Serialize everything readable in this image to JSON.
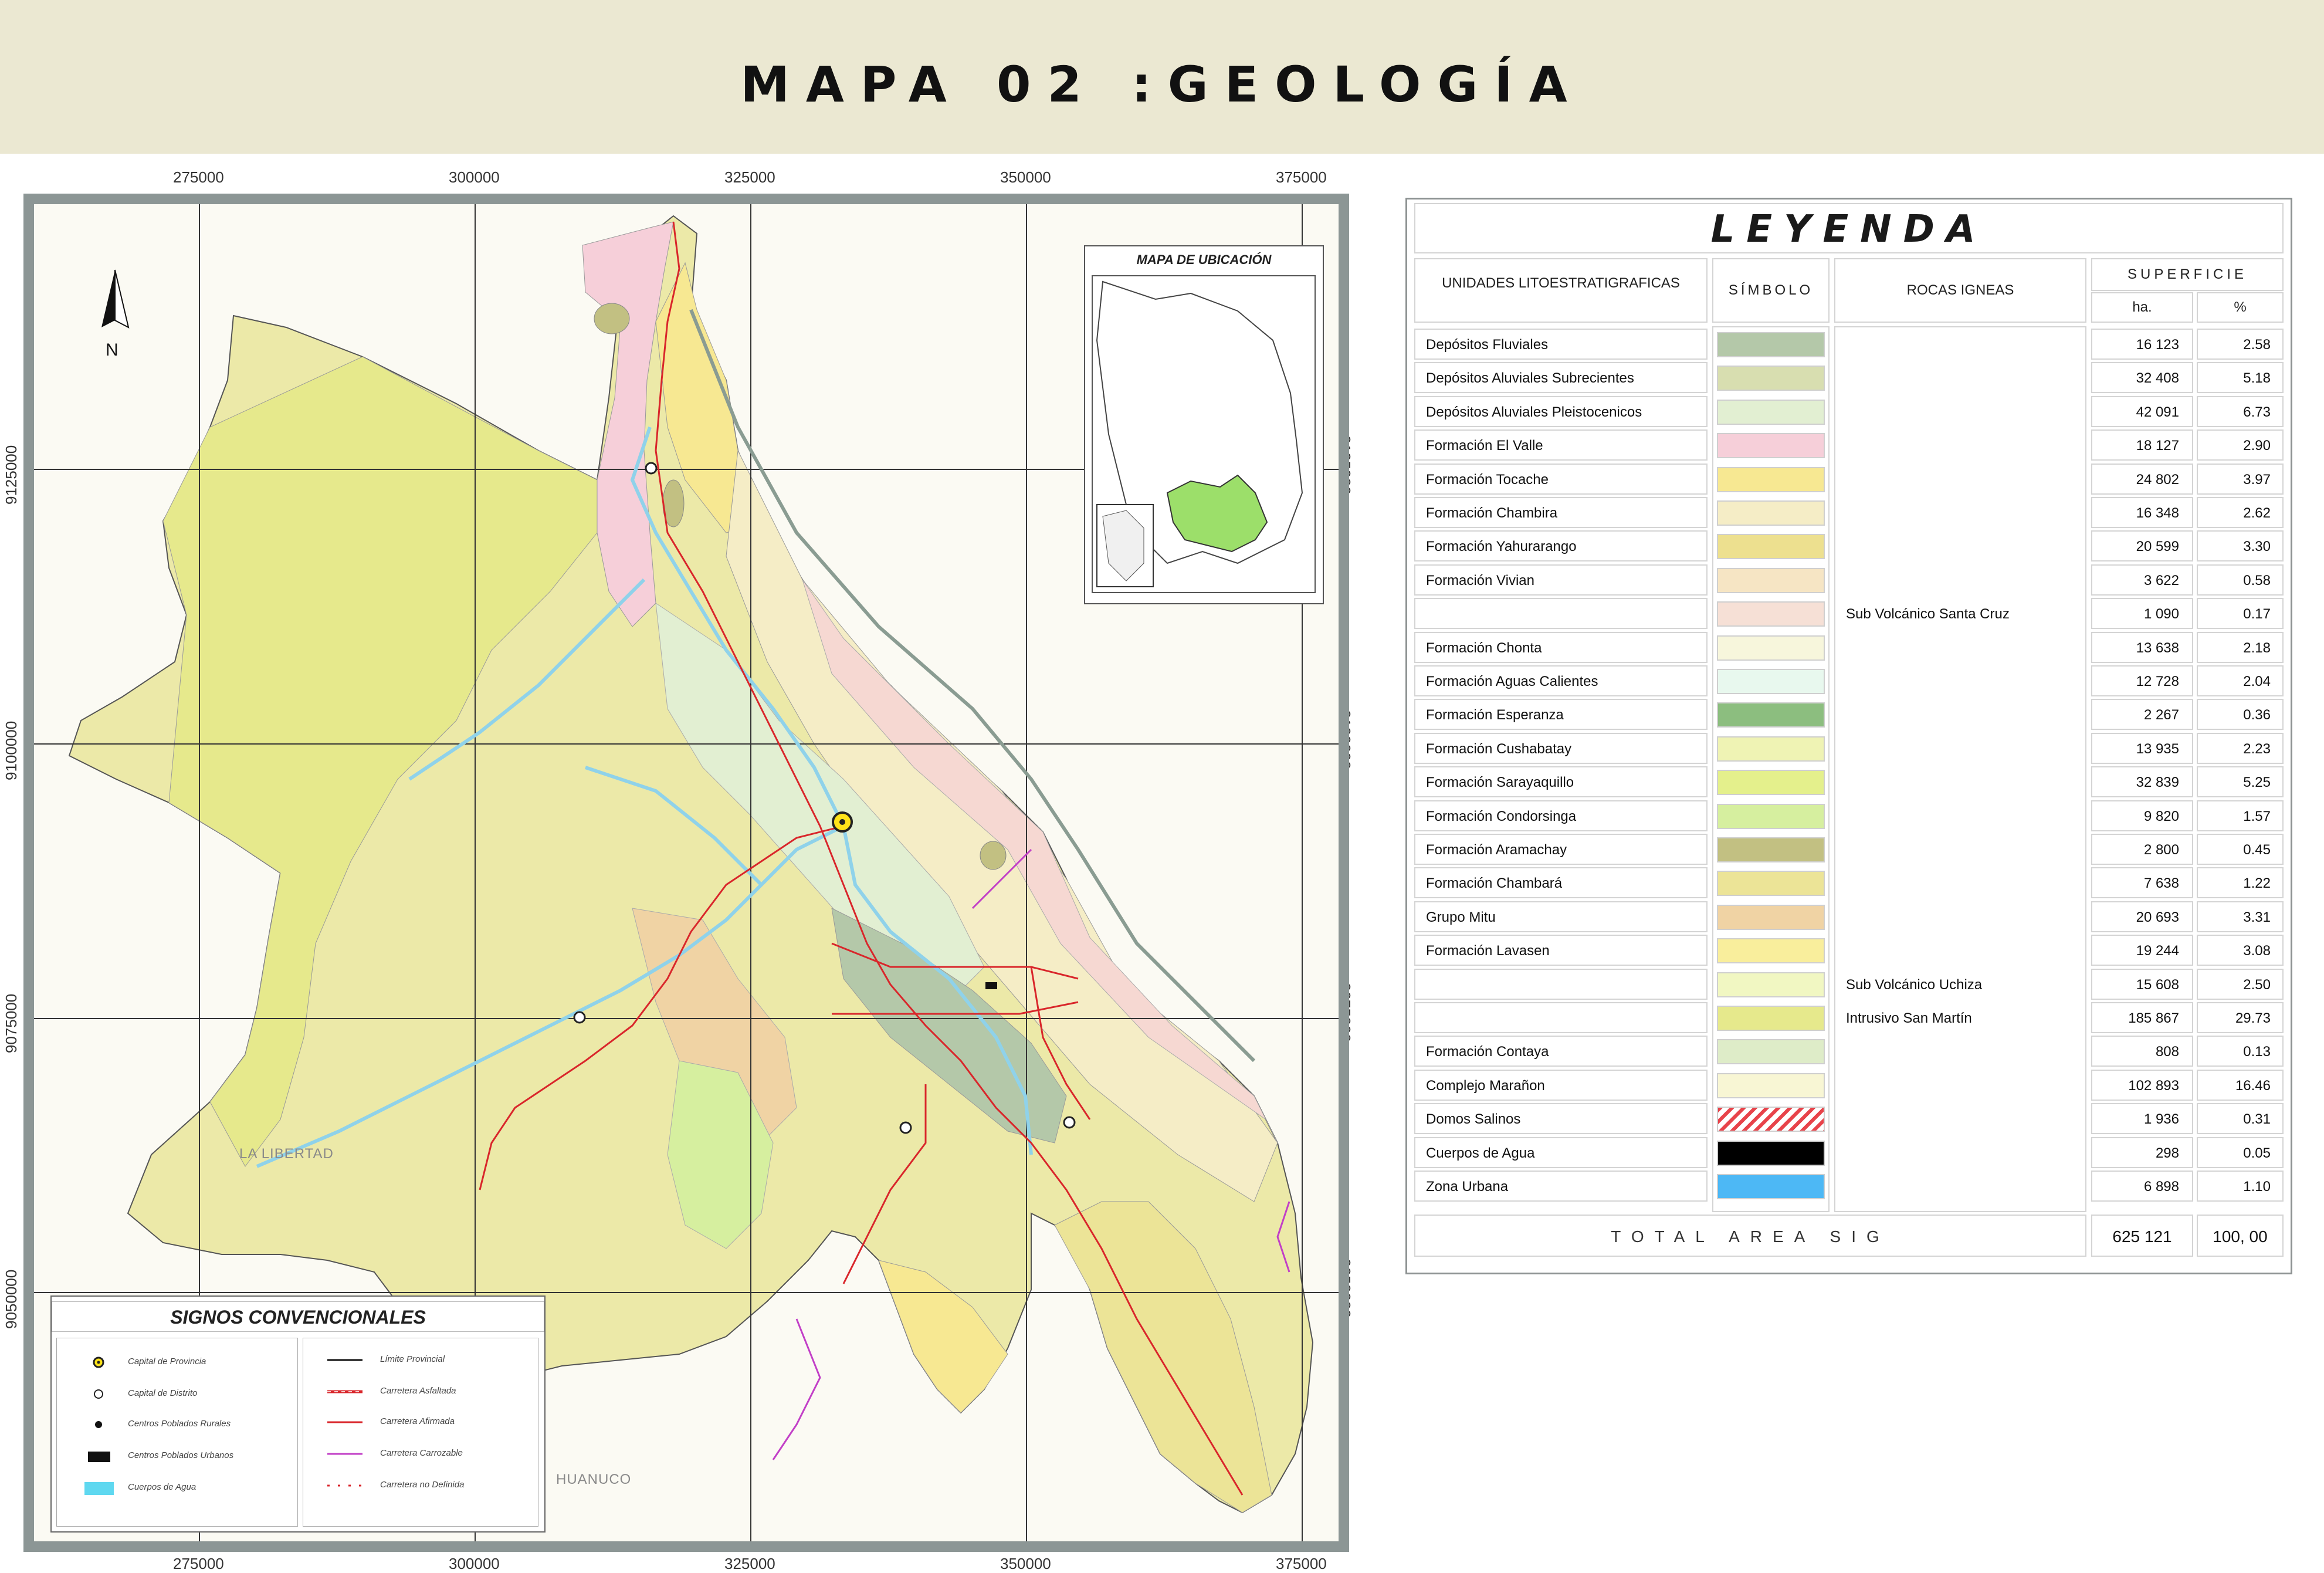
{
  "title": "MAPA 02 :GEOLOGÍA",
  "grid": {
    "x_labels": [
      "275000",
      "300000",
      "325000",
      "350000",
      "375000"
    ],
    "y_labels": [
      "9125000",
      "9100000",
      "9075000",
      "9050000"
    ]
  },
  "map": {
    "north_label": "N",
    "region_labels": [
      "LA LIBERTAD",
      "HUANUCO"
    ],
    "inset_title": "MAPA DE UBICACIÓN",
    "colors": {
      "fluviales": "#b4c8a9",
      "subrecientes": "#d8deb0",
      "pleistocenicos": "#e2efd2",
      "el_valle": "#f6cfd9",
      "tocache": "#f7e892",
      "chambira": "#f5edc6",
      "yahurarango": "#ede08f",
      "vivian": "#f6e5c4",
      "condorsinga": "#d6ef9f",
      "aramachay": "#c2c082",
      "grupo_mitu": "#f0d3a4",
      "san_martin": "#e6e98c",
      "complejo_maranon": "#f8f6d4",
      "water": "#8fd2ea",
      "road": "#d9262b",
      "track": "#c23fc7"
    }
  },
  "conventions": {
    "title": "SIGNOS CONVENCIONALES",
    "left": [
      {
        "label": "Capital de Provincia",
        "icon": "province-capital-icon"
      },
      {
        "label": "Capital de Distrito",
        "icon": "district-capital-icon"
      },
      {
        "label": "Centros Poblados Rurales",
        "icon": "rural-dot-icon"
      },
      {
        "label": "Centros Poblados Urbanos",
        "icon": "urban-block-icon"
      },
      {
        "label": "Cuerpos de Agua",
        "icon": "water-swatch-icon"
      }
    ],
    "right": [
      {
        "label": "Límite Provincial",
        "color": "#111111"
      },
      {
        "label": "Carretera Asfaltada",
        "color": "#d9262b"
      },
      {
        "label": "Carretera Afirmada",
        "color": "#d9262b"
      },
      {
        "label": "Carretera Carrozable",
        "color": "#c23fc7"
      },
      {
        "label": "Carretera no Definida",
        "color": "#d9262b"
      }
    ]
  },
  "legend": {
    "title": "LEYENDA",
    "headers": {
      "units": "UNIDADES LITOESTRATIGRAFICAS",
      "symbol": "SÍMBOLO",
      "igneous": "ROCAS IGNEAS",
      "area": "SUPERFICIE",
      "ha": "ha.",
      "pct": "%"
    },
    "rows": [
      {
        "unit": "Depósitos Fluviales",
        "igneous": "",
        "ha": "16 123",
        "pct": "2.58",
        "color": "#b4c8a9"
      },
      {
        "unit": "Depósitos Aluviales Subrecientes",
        "igneous": "",
        "ha": "32 408",
        "pct": "5.18",
        "color": "#d8deb0"
      },
      {
        "unit": "Depósitos Aluviales Pleistocenicos",
        "igneous": "",
        "ha": "42 091",
        "pct": "6.73",
        "color": "#e2efd2"
      },
      {
        "unit": "Formación El Valle",
        "igneous": "",
        "ha": "18 127",
        "pct": "2.90",
        "color": "#f6cfd9"
      },
      {
        "unit": "Formación Tocache",
        "igneous": "",
        "ha": "24 802",
        "pct": "3.97",
        "color": "#f7e892"
      },
      {
        "unit": "Formación Chambira",
        "igneous": "",
        "ha": "16 348",
        "pct": "2.62",
        "color": "#f5edc6"
      },
      {
        "unit": "Formación Yahurarango",
        "igneous": "",
        "ha": "20 599",
        "pct": "3.30",
        "color": "#ede08f"
      },
      {
        "unit": "Formación Vivian",
        "igneous": "",
        "ha": "3 622",
        "pct": "0.58",
        "color": "#f6e5c4"
      },
      {
        "unit": "",
        "igneous": "Sub Volcánico Santa Cruz",
        "ha": "1 090",
        "pct": "0.17",
        "color": "#f6e0d6"
      },
      {
        "unit": "Formación Chonta",
        "igneous": "",
        "ha": "13 638",
        "pct": "2.18",
        "color": "#f7f6dc"
      },
      {
        "unit": "Formación Aguas Calientes",
        "igneous": "",
        "ha": "12 728",
        "pct": "2.04",
        "color": "#e8f8ee"
      },
      {
        "unit": "Formación Esperanza",
        "igneous": "",
        "ha": "2 267",
        "pct": "0.36",
        "color": "#8cbe7f"
      },
      {
        "unit": "Formación Cushabatay",
        "igneous": "",
        "ha": "13 935",
        "pct": "2.23",
        "color": "#eff3b4"
      },
      {
        "unit": "Formación Sarayaquillo",
        "igneous": "",
        "ha": "32 839",
        "pct": "5.25",
        "color": "#e4f08c"
      },
      {
        "unit": "Formación Condorsinga",
        "igneous": "",
        "ha": "9 820",
        "pct": "1.57",
        "color": "#d6ef9f"
      },
      {
        "unit": "Formación Aramachay",
        "igneous": "",
        "ha": "2 800",
        "pct": "0.45",
        "color": "#c2c082"
      },
      {
        "unit": "Formación Chambará",
        "igneous": "",
        "ha": "7 638",
        "pct": "1.22",
        "color": "#ece497"
      },
      {
        "unit": "Grupo Mitu",
        "igneous": "",
        "ha": "20 693",
        "pct": "3.31",
        "color": "#f0d3a4"
      },
      {
        "unit": "Formación Lavasen",
        "igneous": "",
        "ha": "19 244",
        "pct": "3.08",
        "color": "#f9ee9c"
      },
      {
        "unit": "",
        "igneous": "Sub Volcánico Uchiza",
        "ha": "15 608",
        "pct": "2.50",
        "color": "#f1f7c2"
      },
      {
        "unit": "",
        "igneous": "Intrusivo San Martín",
        "ha": "185 867",
        "pct": "29.73",
        "color": "#e6e98c"
      },
      {
        "unit": "Formación Contaya",
        "igneous": "",
        "ha": "808",
        "pct": "0.13",
        "color": "#deecc8"
      },
      {
        "unit": "Complejo Marañon",
        "igneous": "",
        "ha": "102 893",
        "pct": "16.46",
        "color": "#f8f6d4"
      },
      {
        "unit": "Domos Salinos",
        "igneous": "",
        "ha": "1 936",
        "pct": "0.31",
        "color": "hatch"
      },
      {
        "unit": "Cuerpos de Agua",
        "igneous": "",
        "ha": "298",
        "pct": "0.05",
        "color": "#000000"
      },
      {
        "unit": "Zona Urbana",
        "igneous": "",
        "ha": "6 898",
        "pct": "1.10",
        "color": "#4db8f5"
      }
    ],
    "total_label": "TOTAL AREA SIG",
    "total_ha": "625 121",
    "total_pct": "100, 00"
  }
}
